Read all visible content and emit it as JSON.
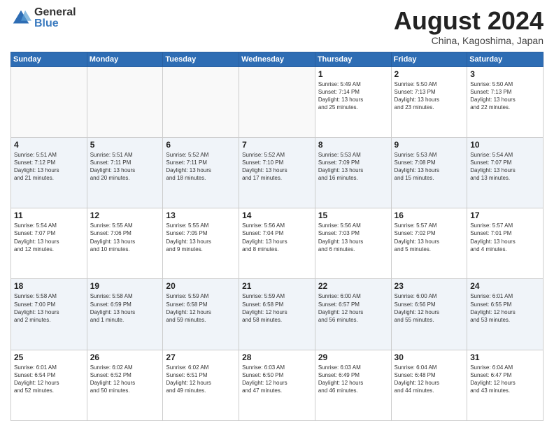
{
  "logo": {
    "general": "General",
    "blue": "Blue"
  },
  "header": {
    "month": "August 2024",
    "location": "China, Kagoshima, Japan"
  },
  "weekdays": [
    "Sunday",
    "Monday",
    "Tuesday",
    "Wednesday",
    "Thursday",
    "Friday",
    "Saturday"
  ],
  "weeks": [
    [
      {
        "day": "",
        "info": ""
      },
      {
        "day": "",
        "info": ""
      },
      {
        "day": "",
        "info": ""
      },
      {
        "day": "",
        "info": ""
      },
      {
        "day": "1",
        "info": "Sunrise: 5:49 AM\nSunset: 7:14 PM\nDaylight: 13 hours\nand 25 minutes."
      },
      {
        "day": "2",
        "info": "Sunrise: 5:50 AM\nSunset: 7:13 PM\nDaylight: 13 hours\nand 23 minutes."
      },
      {
        "day": "3",
        "info": "Sunrise: 5:50 AM\nSunset: 7:13 PM\nDaylight: 13 hours\nand 22 minutes."
      }
    ],
    [
      {
        "day": "4",
        "info": "Sunrise: 5:51 AM\nSunset: 7:12 PM\nDaylight: 13 hours\nand 21 minutes."
      },
      {
        "day": "5",
        "info": "Sunrise: 5:51 AM\nSunset: 7:11 PM\nDaylight: 13 hours\nand 20 minutes."
      },
      {
        "day": "6",
        "info": "Sunrise: 5:52 AM\nSunset: 7:11 PM\nDaylight: 13 hours\nand 18 minutes."
      },
      {
        "day": "7",
        "info": "Sunrise: 5:52 AM\nSunset: 7:10 PM\nDaylight: 13 hours\nand 17 minutes."
      },
      {
        "day": "8",
        "info": "Sunrise: 5:53 AM\nSunset: 7:09 PM\nDaylight: 13 hours\nand 16 minutes."
      },
      {
        "day": "9",
        "info": "Sunrise: 5:53 AM\nSunset: 7:08 PM\nDaylight: 13 hours\nand 15 minutes."
      },
      {
        "day": "10",
        "info": "Sunrise: 5:54 AM\nSunset: 7:07 PM\nDaylight: 13 hours\nand 13 minutes."
      }
    ],
    [
      {
        "day": "11",
        "info": "Sunrise: 5:54 AM\nSunset: 7:07 PM\nDaylight: 13 hours\nand 12 minutes."
      },
      {
        "day": "12",
        "info": "Sunrise: 5:55 AM\nSunset: 7:06 PM\nDaylight: 13 hours\nand 10 minutes."
      },
      {
        "day": "13",
        "info": "Sunrise: 5:55 AM\nSunset: 7:05 PM\nDaylight: 13 hours\nand 9 minutes."
      },
      {
        "day": "14",
        "info": "Sunrise: 5:56 AM\nSunset: 7:04 PM\nDaylight: 13 hours\nand 8 minutes."
      },
      {
        "day": "15",
        "info": "Sunrise: 5:56 AM\nSunset: 7:03 PM\nDaylight: 13 hours\nand 6 minutes."
      },
      {
        "day": "16",
        "info": "Sunrise: 5:57 AM\nSunset: 7:02 PM\nDaylight: 13 hours\nand 5 minutes."
      },
      {
        "day": "17",
        "info": "Sunrise: 5:57 AM\nSunset: 7:01 PM\nDaylight: 13 hours\nand 4 minutes."
      }
    ],
    [
      {
        "day": "18",
        "info": "Sunrise: 5:58 AM\nSunset: 7:00 PM\nDaylight: 13 hours\nand 2 minutes."
      },
      {
        "day": "19",
        "info": "Sunrise: 5:58 AM\nSunset: 6:59 PM\nDaylight: 13 hours\nand 1 minute."
      },
      {
        "day": "20",
        "info": "Sunrise: 5:59 AM\nSunset: 6:58 PM\nDaylight: 12 hours\nand 59 minutes."
      },
      {
        "day": "21",
        "info": "Sunrise: 5:59 AM\nSunset: 6:58 PM\nDaylight: 12 hours\nand 58 minutes."
      },
      {
        "day": "22",
        "info": "Sunrise: 6:00 AM\nSunset: 6:57 PM\nDaylight: 12 hours\nand 56 minutes."
      },
      {
        "day": "23",
        "info": "Sunrise: 6:00 AM\nSunset: 6:56 PM\nDaylight: 12 hours\nand 55 minutes."
      },
      {
        "day": "24",
        "info": "Sunrise: 6:01 AM\nSunset: 6:55 PM\nDaylight: 12 hours\nand 53 minutes."
      }
    ],
    [
      {
        "day": "25",
        "info": "Sunrise: 6:01 AM\nSunset: 6:54 PM\nDaylight: 12 hours\nand 52 minutes."
      },
      {
        "day": "26",
        "info": "Sunrise: 6:02 AM\nSunset: 6:52 PM\nDaylight: 12 hours\nand 50 minutes."
      },
      {
        "day": "27",
        "info": "Sunrise: 6:02 AM\nSunset: 6:51 PM\nDaylight: 12 hours\nand 49 minutes."
      },
      {
        "day": "28",
        "info": "Sunrise: 6:03 AM\nSunset: 6:50 PM\nDaylight: 12 hours\nand 47 minutes."
      },
      {
        "day": "29",
        "info": "Sunrise: 6:03 AM\nSunset: 6:49 PM\nDaylight: 12 hours\nand 46 minutes."
      },
      {
        "day": "30",
        "info": "Sunrise: 6:04 AM\nSunset: 6:48 PM\nDaylight: 12 hours\nand 44 minutes."
      },
      {
        "day": "31",
        "info": "Sunrise: 6:04 AM\nSunset: 6:47 PM\nDaylight: 12 hours\nand 43 minutes."
      }
    ]
  ]
}
